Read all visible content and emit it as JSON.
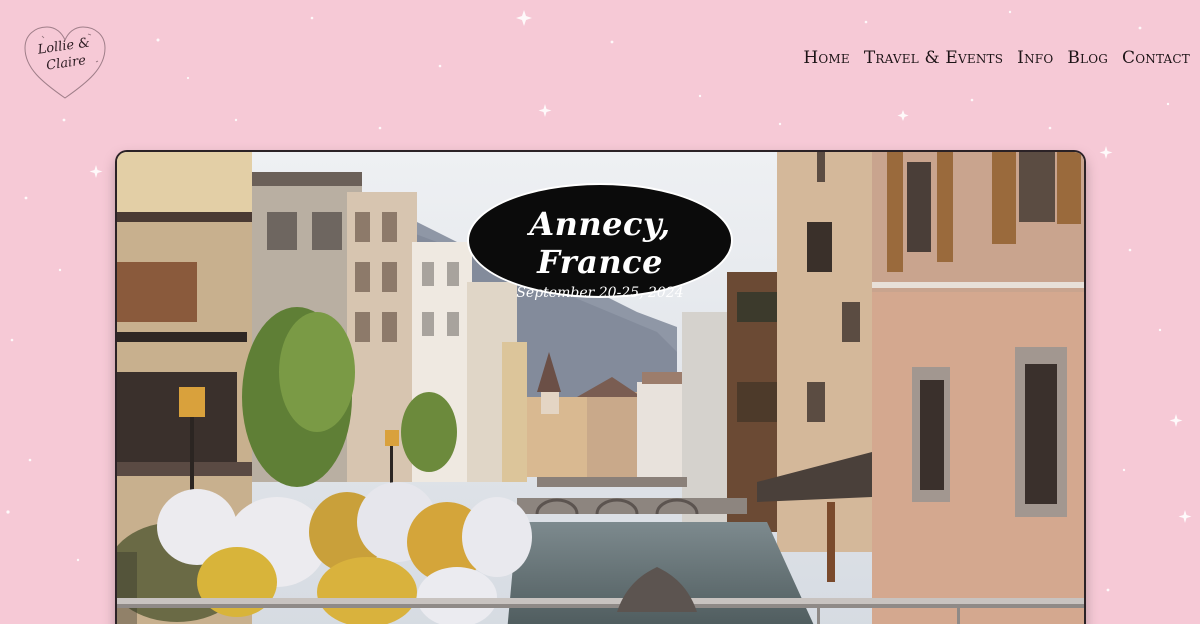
{
  "logo": {
    "line1": "Lollie &",
    "line2": "Claire"
  },
  "nav": {
    "items": [
      {
        "label": "Home"
      },
      {
        "label": "Travel & Events"
      },
      {
        "label": "Info"
      },
      {
        "label": "Blog"
      },
      {
        "label": "Contact"
      }
    ]
  },
  "hero": {
    "title": "Annecy, France",
    "subtitle": "September 20-25, 2024"
  },
  "colors": {
    "background": "#f6c9d6",
    "oval": "#0b0b0b",
    "text_dark": "#1d1417"
  }
}
